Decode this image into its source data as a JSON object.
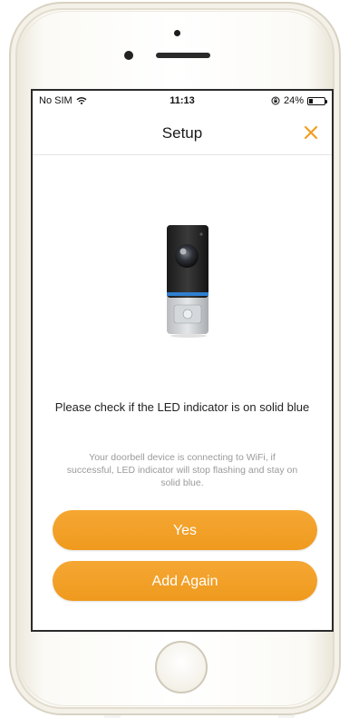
{
  "status_bar": {
    "carrier": "No SIM",
    "time": "11:13",
    "battery_percent": "24%",
    "battery_level": 0.24
  },
  "nav": {
    "title": "Setup",
    "close_icon": "close-icon"
  },
  "content": {
    "headline": "Please check if the LED indicator is on solid blue",
    "subtext": "Your doorbell device is connecting to WiFi, if successful, LED indicator will stop flashing and stay on solid blue."
  },
  "buttons": {
    "yes_label": "Yes",
    "add_again_label": "Add Again"
  },
  "colors": {
    "accent": "#F29E22",
    "close_icon": "#F29E22"
  }
}
